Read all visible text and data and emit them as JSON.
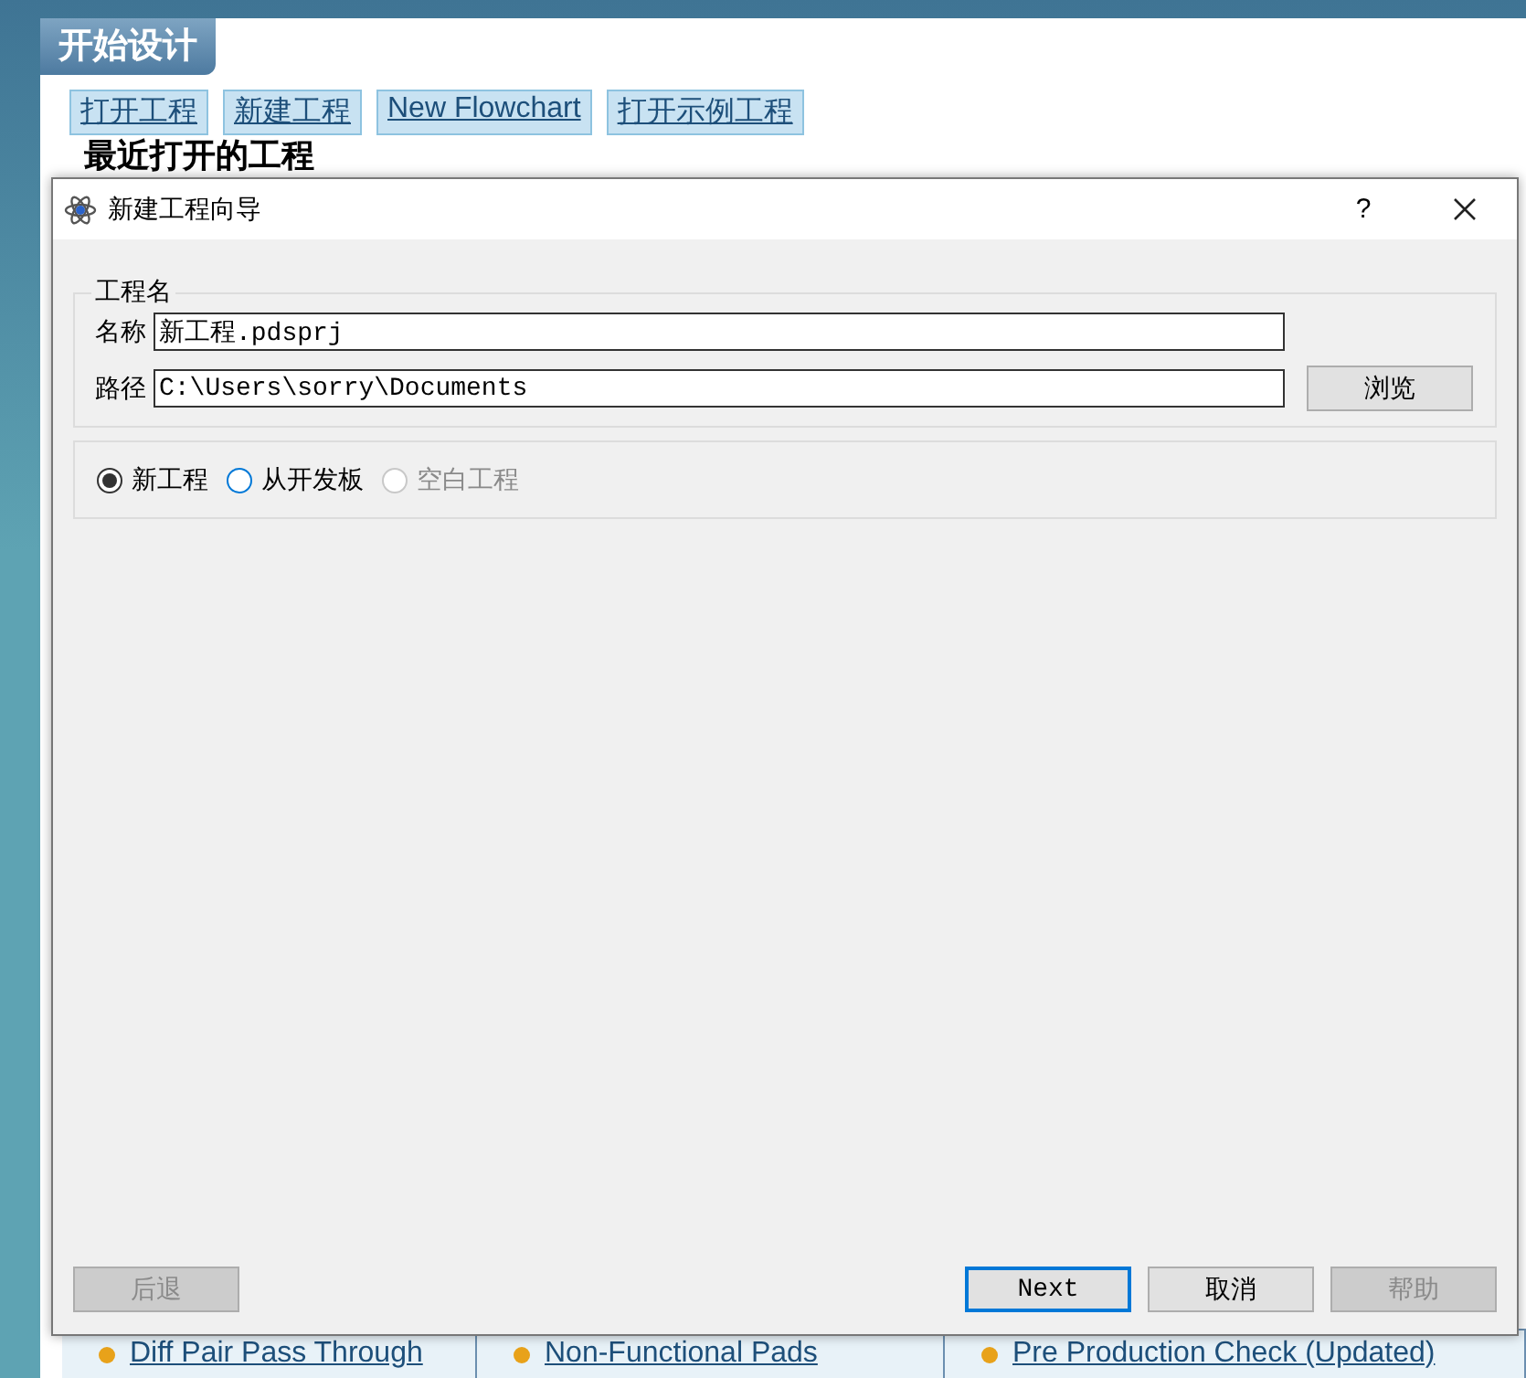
{
  "page": {
    "title": "开始设计",
    "buttons": [
      "打开工程",
      "新建工程",
      "New Flowchart",
      "打开示例工程"
    ],
    "recent_heading": "最近打开的工程",
    "sample_links": [
      "Diff Pair Pass Through",
      "Non-Functional Pads",
      "Pre Production Check (Updated)"
    ]
  },
  "dialog": {
    "title": "新建工程向导",
    "help": "?",
    "group_title": "工程名",
    "fields": [
      {
        "label": "名称",
        "value": "新工程.pdsprj"
      },
      {
        "label": "路径",
        "value": "C:\\Users\\sorry\\Documents"
      }
    ],
    "browse": "浏览",
    "options": [
      {
        "label": "新工程",
        "selected": true,
        "focused": false,
        "disabled": false
      },
      {
        "label": "从开发板",
        "selected": false,
        "focused": true,
        "disabled": false
      },
      {
        "label": "空白工程",
        "selected": false,
        "focused": false,
        "disabled": true
      }
    ],
    "buttons": [
      {
        "label": "后退",
        "disabled": true,
        "default": false
      },
      {
        "label": "Next",
        "disabled": false,
        "default": true
      },
      {
        "label": "取消",
        "disabled": false,
        "default": false
      },
      {
        "label": "帮助",
        "disabled": true,
        "default": false
      }
    ]
  }
}
